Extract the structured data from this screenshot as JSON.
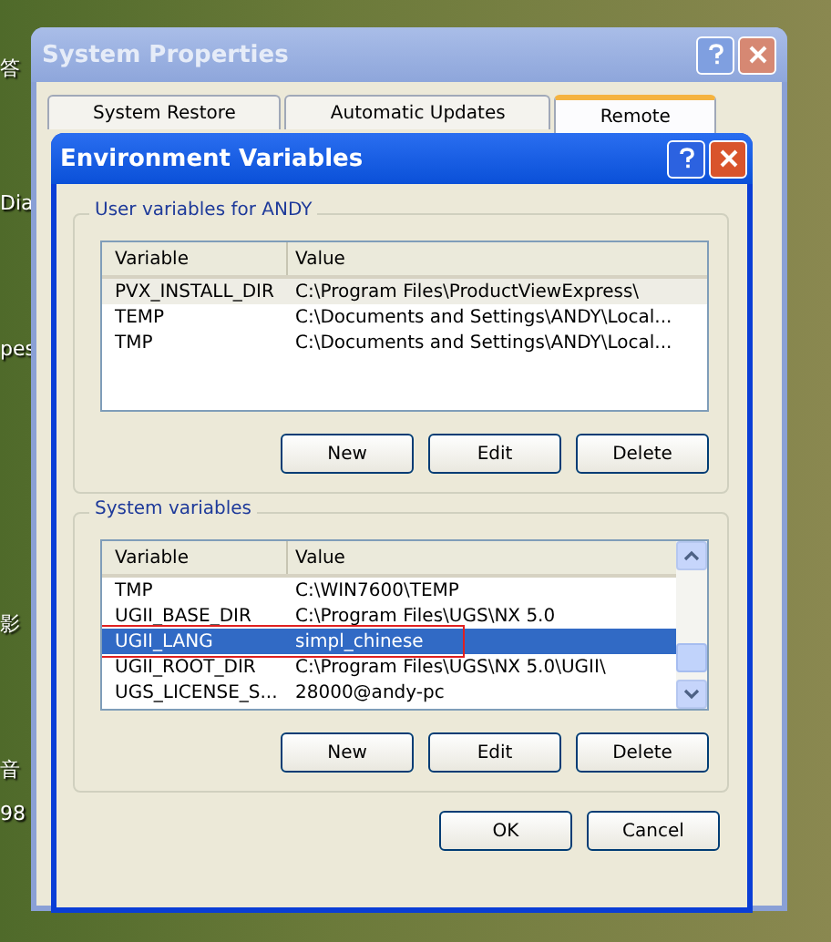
{
  "desktop_icons": [
    {
      "label": "答"
    },
    {
      "label": "Dia"
    },
    {
      "label": "pes"
    },
    {
      "label": "影"
    },
    {
      "label": "音"
    },
    {
      "label": "98"
    }
  ],
  "system_properties": {
    "title": "System Properties",
    "tabs": [
      {
        "label": "System Restore",
        "selected": false
      },
      {
        "label": "Automatic Updates",
        "selected": false
      },
      {
        "label": "Remote",
        "selected": true
      }
    ]
  },
  "environment_variables": {
    "title": "Environment Variables",
    "user_variables": {
      "label": "User variables for ANDY",
      "columns": [
        "Variable",
        "Value"
      ],
      "rows": [
        {
          "variable": "PVX_INSTALL_DIR",
          "value": "C:\\Program Files\\ProductViewExpress\\",
          "selected": true
        },
        {
          "variable": "TEMP",
          "value": "C:\\Documents and Settings\\ANDY\\Local...",
          "selected": false
        },
        {
          "variable": "TMP",
          "value": "C:\\Documents and Settings\\ANDY\\Local...",
          "selected": false
        }
      ],
      "buttons": [
        "New",
        "Edit",
        "Delete"
      ]
    },
    "system_variables": {
      "label": "System variables",
      "columns": [
        "Variable",
        "Value"
      ],
      "rows": [
        {
          "variable": "TMP",
          "value": "C:\\WIN7600\\TEMP",
          "selected": false
        },
        {
          "variable": "UGII_BASE_DIR",
          "value": "C:\\Program Files\\UGS\\NX 5.0",
          "selected": false
        },
        {
          "variable": "UGII_LANG",
          "value": "simpl_chinese",
          "selected": true
        },
        {
          "variable": "UGII_ROOT_DIR",
          "value": "C:\\Program Files\\UGS\\NX 5.0\\UGII\\",
          "selected": false
        },
        {
          "variable": "UGS_LICENSE_S...",
          "value": "28000@andy-pc",
          "selected": false
        }
      ],
      "buttons": [
        "New",
        "Edit",
        "Delete"
      ]
    },
    "buttons": [
      "OK",
      "Cancel"
    ]
  }
}
